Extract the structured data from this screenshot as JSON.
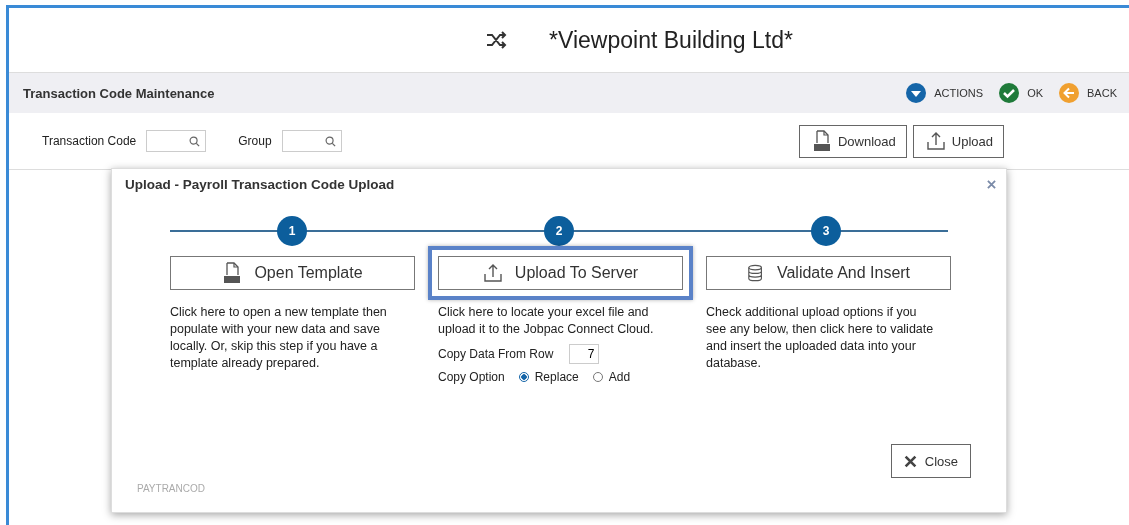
{
  "window": {
    "title": "*Viewpoint Building Ltd*"
  },
  "toolbar": {
    "title": "Transaction Code Maintenance",
    "actions": [
      {
        "label": "ACTIONS",
        "kind": "actions"
      },
      {
        "label": "OK",
        "kind": "ok"
      },
      {
        "label": "BACK",
        "kind": "back"
      }
    ]
  },
  "filters": [
    {
      "label": "Transaction Code"
    },
    {
      "label": "Group"
    }
  ],
  "buttons": [
    {
      "label": "Download",
      "kind": "xls"
    },
    {
      "label": "Upload",
      "kind": "upload"
    }
  ],
  "dialog": {
    "title": "Upload - Payroll Transaction Code Upload",
    "steps": [
      {
        "number": "1",
        "button": "Open Template",
        "kind": "xls",
        "highlighted": false,
        "description": "Click here to open a new template then populate with your new data and save locally. Or, skip this step if you have a template already prepared."
      },
      {
        "number": "2",
        "button": "Upload To Server",
        "kind": "upload",
        "highlighted": true,
        "description": "Click here to locate your excel file and upload it to the Jobpac Connect Cloud."
      },
      {
        "number": "3",
        "button": "Validate And Insert",
        "kind": "database",
        "highlighted": false,
        "description": "Check additional upload options if you see any below, then click here to validate and insert the uploaded data into your database."
      }
    ],
    "copy_from_row": {
      "label": "Copy Data From Row",
      "value": "7"
    },
    "copy_option": {
      "label": "Copy Option",
      "options": [
        {
          "label": "Replace",
          "selected": true
        },
        {
          "label": "Add",
          "selected": false
        }
      ]
    },
    "footer_code": "PAYTRANCOD",
    "close": "Close"
  }
}
